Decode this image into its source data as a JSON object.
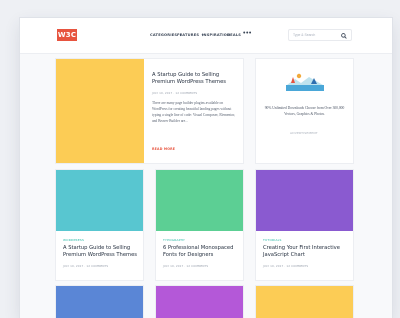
{
  "header": {
    "logo": "W3C",
    "nav": [
      {
        "label": "CATEGORIES",
        "has_caret": true
      },
      {
        "label": "FEATURES",
        "has_caret": true
      },
      {
        "label": "INSPIRATION",
        "has_caret": false
      },
      {
        "label": "DEALS",
        "has_caret": false
      }
    ],
    "more_icon": "ellipsis-icon",
    "search_placeholder": "Type & Search",
    "search_icon": "search-icon"
  },
  "featured": {
    "title": "A Startup Guide to Selling Premium WordPress Themes",
    "meta": "JULY 10, 2017  ·  12 COMMENTS",
    "excerpt": "There are many page builder plugins available on WordPress for creating beautiful landing pages without typing a single line of code: Visual Composer, Elementor, and Beaver Builder are...",
    "read_more": "READ MORE",
    "thumb_color": "#fccc55"
  },
  "ad": {
    "text": "90% Unlimited Downloads Choose from Over 300,000 Vectors, Graphics & Photos.",
    "label": "ADVERTISEMENT"
  },
  "cards": [
    {
      "tag": "WORDPRESS",
      "title": "A Startup Guide to Selling Premium WordPress Themes",
      "meta": "JULY 10, 2017  ·  12 COMMENTS",
      "color": "#58c6d0"
    },
    {
      "tag": "TYPOGRAPHY",
      "title": "6 Professional Monospaced Fonts for Designers",
      "meta": "JULY 10, 2017  ·  12 COMMENTS",
      "color": "#5ccf94"
    },
    {
      "tag": "TUTORIALS",
      "title": "Creating Your First Interactive JavaScript Chart",
      "meta": "JULY 10, 2017  ·  12 COMMENTS",
      "color": "#8a5ad0"
    }
  ],
  "bottom_row_colors": [
    "#5a86d6",
    "#b458d8",
    "#fccc55"
  ]
}
